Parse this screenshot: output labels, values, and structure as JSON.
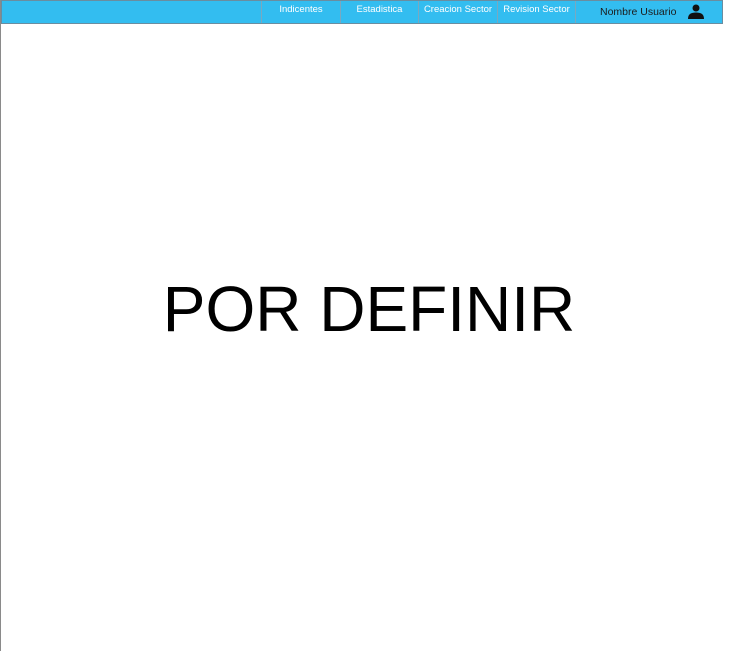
{
  "nav": {
    "items": [
      {
        "label": "Indicentes"
      },
      {
        "label": "Estadistica"
      },
      {
        "label": "Creacion Sector"
      },
      {
        "label": "Revision Sector"
      }
    ],
    "user": {
      "name": "Nombre Usuario",
      "icon": "user-icon"
    }
  },
  "main": {
    "placeholder_text": "POR DEFINIR"
  },
  "colors": {
    "nav_background": "#33bdf0",
    "nav_text": "#ffffff",
    "user_text": "#1c1c1c",
    "page_background": "#ffffff"
  }
}
